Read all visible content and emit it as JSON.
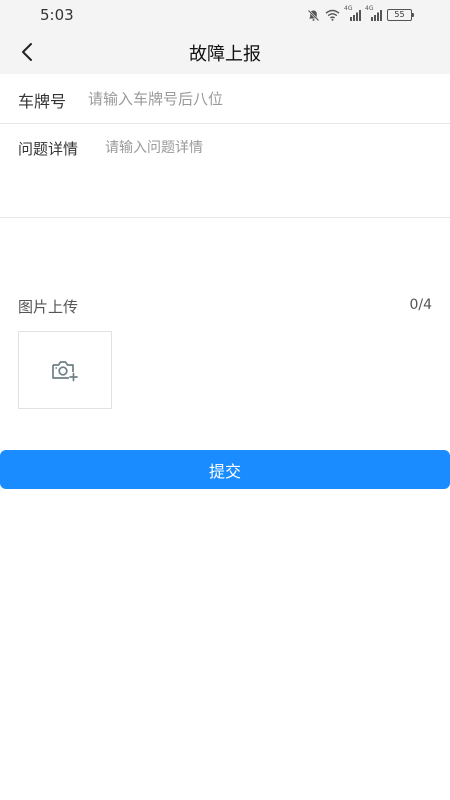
{
  "status_bar": {
    "time": "5:03",
    "battery": "55",
    "icons": [
      "bell-off-icon",
      "wifi-icon",
      "signal-4g-icon",
      "signal-4g-icon",
      "battery-icon"
    ],
    "network_labels": [
      "4G",
      "4G"
    ]
  },
  "nav": {
    "title": "故障上报",
    "back_icon": "chevron-left-icon"
  },
  "form": {
    "plate_label": "车牌号",
    "plate_placeholder": "请输入车牌号后八位",
    "detail_label": "问题详情",
    "detail_placeholder": "请输入问题详情"
  },
  "upload": {
    "label": "图片上传",
    "count": "0/4",
    "icon": "camera-add-icon"
  },
  "submit": {
    "label": "提交",
    "color": "#1a8cff"
  }
}
